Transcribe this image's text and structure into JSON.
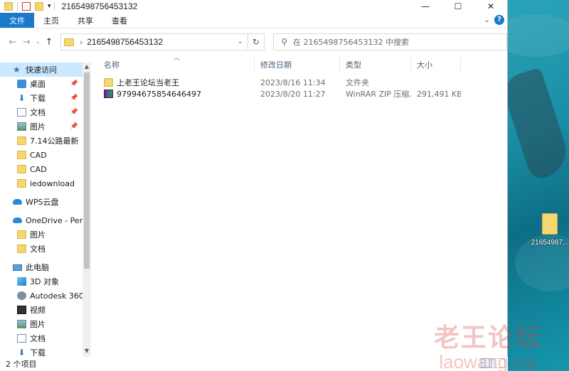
{
  "window": {
    "title": "2165498756453132",
    "controls": {
      "minimize": "—",
      "maximize": "☐",
      "close": "✕"
    }
  },
  "ribbon": {
    "tabs": [
      "文件",
      "主页",
      "共享",
      "查看"
    ]
  },
  "address": {
    "path": "2165498756453132",
    "search_placeholder": "在 2165498756453132 中搜索"
  },
  "nav": {
    "items": [
      {
        "label": "快速访问",
        "icon": "star-icon"
      },
      {
        "label": "桌面",
        "icon": "desktop-icon",
        "pinned": true
      },
      {
        "label": "下载",
        "icon": "download-icon",
        "pinned": true
      },
      {
        "label": "文档",
        "icon": "document-icon",
        "pinned": true
      },
      {
        "label": "图片",
        "icon": "picture-icon",
        "pinned": true
      },
      {
        "label": "7.14公路最新",
        "icon": "folder-icon"
      },
      {
        "label": "CAD",
        "icon": "folder-icon"
      },
      {
        "label": "CAD",
        "icon": "folder-icon"
      },
      {
        "label": "iedownload",
        "icon": "folder-icon"
      },
      {
        "label": "WPS云盘",
        "icon": "cloud-icon"
      },
      {
        "label": "OneDrive - Personal",
        "icon": "onedrive-icon"
      },
      {
        "label": "图片",
        "icon": "folder-icon"
      },
      {
        "label": "文档",
        "icon": "folder-icon"
      },
      {
        "label": "此电脑",
        "icon": "computer-icon"
      },
      {
        "label": "3D 对象",
        "icon": "3d-objects-icon"
      },
      {
        "label": "Autodesk 360",
        "icon": "autodesk-icon"
      },
      {
        "label": "视频",
        "icon": "video-icon"
      },
      {
        "label": "图片",
        "icon": "picture-icon"
      },
      {
        "label": "文档",
        "icon": "document-icon"
      },
      {
        "label": "下载",
        "icon": "download-icon"
      }
    ]
  },
  "columns": {
    "name": "名称",
    "date": "修改日期",
    "type": "类型",
    "size": "大小"
  },
  "files": [
    {
      "name": "上老王论坛当老王",
      "date": "2023/8/16 11:34",
      "type": "文件夹",
      "size": "",
      "icon": "folder-icon"
    },
    {
      "name": "97994675854646497",
      "date": "2023/8/20 11:27",
      "type": "WinRAR ZIP 压缩...",
      "size": "291,491 KB",
      "icon": "winrar-icon"
    }
  ],
  "status": {
    "count": "2 个项目"
  },
  "desktop": {
    "icon_label": "21654987..."
  },
  "watermark": {
    "line1": "老王论坛",
    "line2": "laowang.vip"
  },
  "colors": {
    "accent": "#1979ca",
    "selection": "#cce8ff",
    "folder": "#f6d66f"
  }
}
